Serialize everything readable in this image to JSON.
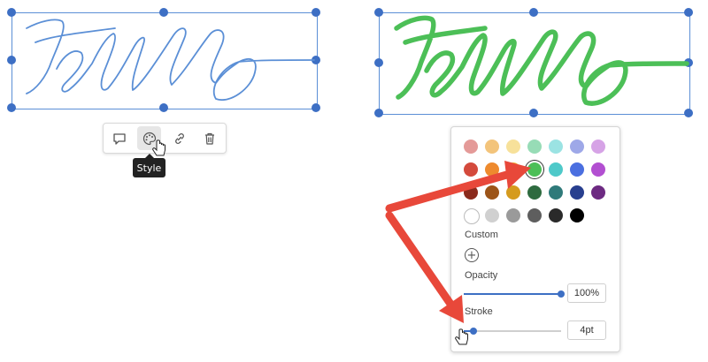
{
  "accent_color": "#3d6fc4",
  "left_ink": {
    "color": "#5b8fd6",
    "text": "Hello"
  },
  "right_ink": {
    "color": "#4cbf57",
    "text": "Hello"
  },
  "toolbar": {
    "buttons": [
      {
        "name": "comment-icon"
      },
      {
        "name": "palette-icon"
      },
      {
        "name": "link-icon"
      },
      {
        "name": "trash-icon"
      }
    ],
    "tooltip": "Style"
  },
  "style_panel": {
    "swatch_colors": [
      [
        "#e49a98",
        "#f3c47b",
        "#f7e19a",
        "#97dcb6",
        "#9be3e3",
        "#9ea8e8",
        "#d6a3e6"
      ],
      [
        "#d44a3c",
        "#ee8a2e",
        "#f2c33a",
        "#4cbf57",
        "#4ec9c9",
        "#4b6fe0",
        "#b24fd1"
      ],
      [
        "#8a2a1c",
        "#9c5418",
        "#d59b1e",
        "#2e6b3f",
        "#2f7a7a",
        "#283f8f",
        "#6d2a82"
      ],
      [
        "#ffffff",
        "#d0d0d0",
        "#9a9a9a",
        "#5e5e5e",
        "#2a2a2a",
        "#000000"
      ]
    ],
    "selected_color": "#4cbf57",
    "custom_label": "Custom",
    "opacity_label": "Opacity",
    "opacity_value": "100%",
    "opacity_fraction": 1.0,
    "stroke_label": "Stroke",
    "stroke_value": "4pt",
    "stroke_fraction": 0.1
  },
  "annotation_arrow_color": "#e8483a"
}
